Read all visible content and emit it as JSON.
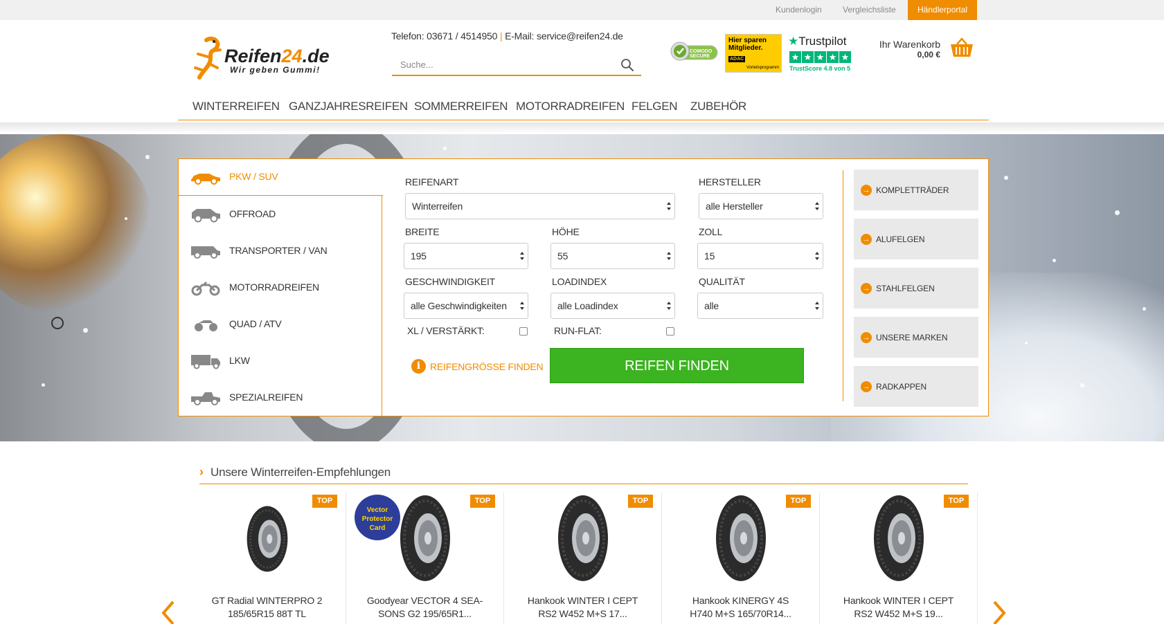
{
  "topbar": {
    "links": [
      {
        "label": "Kundenlogin"
      },
      {
        "label": "Vergleichsliste"
      },
      {
        "label": "Händlerportal"
      }
    ]
  },
  "header": {
    "logo_text_a": "Reifen",
    "logo_text_b": "24",
    "logo_text_c": ".de",
    "logo_slogan": "Wir geben Gummi!",
    "phone": "Telefon: 03671 / 4514950",
    "separator": "|",
    "email": "E-Mail: service@reifen24.de",
    "search_placeholder": "Suche...",
    "badges": {
      "comodo": "COMODO SECURE",
      "adac_line1": "Hier sparen",
      "adac_line2": "Mitglieder.",
      "adac_brand": "ADAC",
      "adac_sub": "Vorteilsprogramm",
      "trustpilot": "Trustpilot",
      "trustscore": "TrustScore 4.8 von 5",
      "rating": 4.8
    },
    "cart_label": "Ihr Warenkorb",
    "cart_value": "0,00 €"
  },
  "nav": {
    "items": [
      {
        "label": "WINTERREIFEN"
      },
      {
        "label": "GANZJAHRESREIFEN"
      },
      {
        "label": "SOMMERREIFEN"
      },
      {
        "label": "MOTORRADREIFEN"
      },
      {
        "label": "FELGEN"
      },
      {
        "label": "ZUBEHÖR"
      }
    ]
  },
  "finder": {
    "tabs": [
      {
        "label": "PKW / SUV",
        "icon": "car-icon"
      },
      {
        "label": "OFFROAD",
        "icon": "offroad-car-icon"
      },
      {
        "label": "TRANSPORTER / VAN",
        "icon": "van-icon"
      },
      {
        "label": "MOTORRADREIFEN",
        "icon": "motorcycle-icon"
      },
      {
        "label": "QUAD / ATV",
        "icon": "quad-icon"
      },
      {
        "label": "LKW",
        "icon": "truck-icon"
      },
      {
        "label": "SPEZIALREIFEN",
        "icon": "special-vehicle-icon"
      }
    ],
    "fields": {
      "reifenart": {
        "label": "REIFENART",
        "value": "Winterreifen"
      },
      "hersteller": {
        "label": "HERSTELLER",
        "value": "alle Hersteller"
      },
      "breite": {
        "label": "BREITE",
        "value": "195"
      },
      "hoehe": {
        "label": "HÖHE",
        "value": "55"
      },
      "zoll": {
        "label": "ZOLL",
        "value": "15"
      },
      "geschwindigkeit": {
        "label": "GESCHWINDIGKEIT",
        "value": "alle Geschwindigkeiten"
      },
      "loadindex": {
        "label": "LOADINDEX",
        "value": "alle Loadindex"
      },
      "qualitaet": {
        "label": "QUALITÄT",
        "value": "alle"
      }
    },
    "xl_label": "XL / VERSTÄRKT:",
    "runflat_label": "RUN-FLAT:",
    "size_help": "REIFENGRÖSSE FINDEN",
    "find_button": "REIFEN FINDEN",
    "quick_links": [
      {
        "label": "KOMPLETTRÄDER"
      },
      {
        "label": "ALUFELGEN"
      },
      {
        "label": "STAHLFELGEN"
      },
      {
        "label": "UNSERE MARKEN"
      },
      {
        "label": "RADKAPPEN"
      }
    ]
  },
  "recommendations": {
    "title": "Unsere Winterreifen-Empfehlungen",
    "badge": "TOP",
    "products": [
      {
        "line1": "GT Radial WINTERPRO 2",
        "line2": "185/65R15 88T TL"
      },
      {
        "line1": "Goodyear VECTOR 4 SEA-",
        "line2": "SONS G2 195/65R1...",
        "promo": "Vector Protector Card"
      },
      {
        "line1": "Hankook WINTER I CEPT",
        "line2": "RS2 W452 M+S 17..."
      },
      {
        "line1": "Hankook KINERGY 4S",
        "line2": "H740 M+S 165/70R14..."
      },
      {
        "line1": "Hankook WINTER I CEPT",
        "line2": "RS2 W452 M+S 19..."
      }
    ]
  },
  "colors": {
    "accent": "#f08c00",
    "find_button": "#3cb320",
    "trustpilot": "#00b67a"
  }
}
